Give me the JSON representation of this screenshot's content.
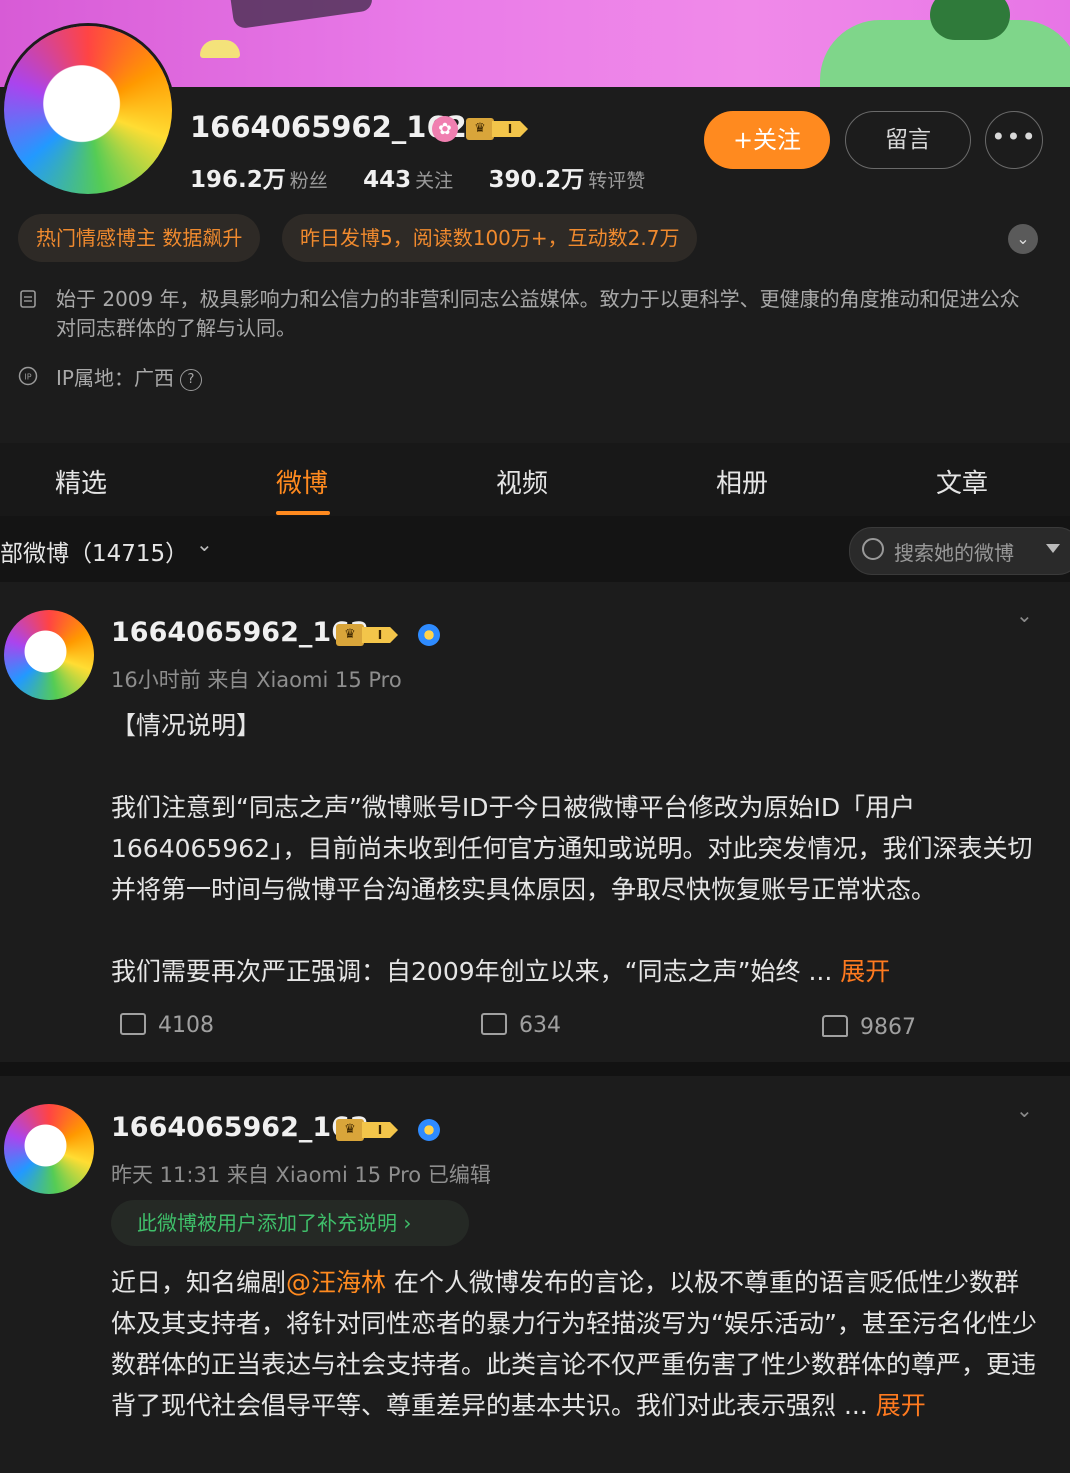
{
  "profile": {
    "username": "1664065962_162",
    "badge_level": "I",
    "stats": {
      "fans_value": "196.2万",
      "fans_label": "粉丝",
      "follow_value": "443",
      "follow_label": "关注",
      "repost_value": "390.2万",
      "repost_label": "转评赞"
    },
    "follow_button": "+关注",
    "message_button": "留言",
    "more_button": "•••",
    "tags": [
      "热门情感博主 数据飙升",
      "昨日发博5，阅读数100万+，互动数2.7万"
    ],
    "bio": "始于 2009 年，极具影响力和公信力的非营利同志公益媒体。致力于以更科学、更健康的角度推动和促进公众对同志群体的了解与认同。",
    "ip_label": "IP属地：广西",
    "ip_help": "?"
  },
  "tabs": [
    "精选",
    "微博",
    "视频",
    "相册",
    "文章"
  ],
  "active_tab": "微博",
  "filter": {
    "label": "部微博（14715）",
    "chevron": "⌄"
  },
  "search": {
    "placeholder": "搜索她的微博"
  },
  "posts": [
    {
      "author": "1664065962_162",
      "meta": "16小时前  来自 Xiaomi 15 Pro",
      "para1": "【情况说明】",
      "para2": "我们注意到“同志之声”微博账号ID于今日被微博平台修改为原始ID「用户1664065962」，目前尚未收到任何官方通知或说明。对此突发情况，我们深表关切并将第一时间与微博平台沟通核实具体原因，争取尽快恢复账号正常状态。",
      "para3": "我们需要再次严正强调：自2009年创立以来，“同志之声”始终",
      "ellipsis": " ... ",
      "expand": "展开",
      "reposts": "4108",
      "comments": "634",
      "likes": "9867"
    },
    {
      "author": "1664065962_162",
      "meta": "昨天 11:31  来自 Xiaomi 15 Pro 已编辑",
      "supplement": "此微博被用户添加了补充说明 ›",
      "text_before": "近日，知名编剧",
      "mention": "@汪海林",
      "text_after": " 在个人微博发布的言论，以极不尊重的语言贬低性少数群体及其支持者，将针对同性恋者的暴力行为轻描淡写为“娱乐活动”，甚至污名化性少数群体的正当表达与社会支持者。此类言论不仅严重伤害了性少数群体的尊严，更违背了现代社会倡导平等、尊重差异的基本共识。我们对此表示强烈",
      "ellipsis": " ... ",
      "expand": "展开"
    }
  ],
  "colors": {
    "accent": "#ff8a1f",
    "background": "#1c1c1c",
    "supplement_green": "#3fbf6a",
    "banner_pink": "#e97be8"
  }
}
